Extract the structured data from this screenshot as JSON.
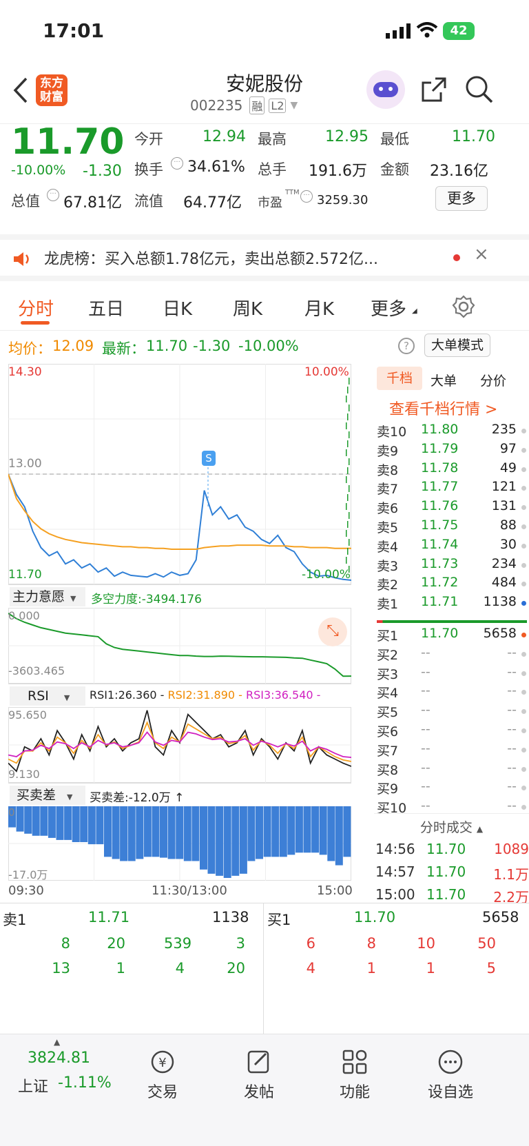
{
  "status_bar": {
    "time": "17:01",
    "battery": "42"
  },
  "header": {
    "title": "安妮股份",
    "code": "002235",
    "tag_margin": "融",
    "tag_level": "L2",
    "logo_line1": "东方",
    "logo_line2": "财富"
  },
  "quote": {
    "price": "11.70",
    "change_pct": "-10.00%",
    "change": "-1.30",
    "open_label": "今开",
    "open": "12.94",
    "high_label": "最高",
    "high": "12.95",
    "low_label": "最低",
    "low": "11.70",
    "turnover_label": "换手",
    "turnover": "34.61%",
    "volume_label": "总手",
    "volume": "191.6万",
    "amount_label": "金额",
    "amount": "23.16亿",
    "mktcap_label": "总值",
    "mktcap": "67.81亿",
    "float_label": "流值",
    "float": "64.77亿",
    "pe_label": "市盈",
    "pe_sup": "TTM",
    "pe": "3259.30",
    "more_label": "更多"
  },
  "banner": {
    "text": "龙虎榜：买入总额1.78亿元，卖出总额2.572亿..."
  },
  "tabs": [
    "分时",
    "五日",
    "日K",
    "周K",
    "月K",
    "更多"
  ],
  "info_bar": {
    "avg_label": "均价：",
    "avg": "12.09",
    "last_label": "最新：",
    "last": "11.70",
    "chg": "-1.30",
    "pct": "-10.00%",
    "mode_btn": "大单模式"
  },
  "chart_data": [
    {
      "type": "line",
      "title": "",
      "y_top_label": "14.30",
      "y_mid_label": "13.00",
      "y_bot_label": "11.70",
      "pct_top": "10.00%",
      "pct_bot": "-10.00%",
      "ylim": [
        11.7,
        14.3
      ],
      "x_labels": [
        "09:30",
        "11:30/13:00",
        "15:00"
      ],
      "series": [
        {
          "name": "price",
          "color": "#2f7fd6",
          "values": [
            13.0,
            12.75,
            12.6,
            12.3,
            12.1,
            12.0,
            12.05,
            11.9,
            11.95,
            11.85,
            11.9,
            11.8,
            11.85,
            11.75,
            11.8,
            11.76,
            11.75,
            11.74,
            11.78,
            11.74,
            11.8,
            11.76,
            11.78,
            11.95,
            12.8,
            12.5,
            12.6,
            12.45,
            12.5,
            12.35,
            12.3,
            12.2,
            12.15,
            12.25,
            12.1,
            12.05,
            11.9,
            11.8,
            11.75,
            11.76,
            11.73,
            11.71,
            11.7
          ]
        },
        {
          "name": "avg",
          "color": "#f5a020",
          "values": [
            13.0,
            12.7,
            12.55,
            12.42,
            12.33,
            12.27,
            12.23,
            12.2,
            12.18,
            12.16,
            12.15,
            12.14,
            12.13,
            12.12,
            12.11,
            12.11,
            12.1,
            12.1,
            12.09,
            12.09,
            12.08,
            12.08,
            12.08,
            12.08,
            12.1,
            12.11,
            12.12,
            12.12,
            12.13,
            12.13,
            12.13,
            12.13,
            12.12,
            12.12,
            12.12,
            12.11,
            12.11,
            12.1,
            12.1,
            12.1,
            12.09,
            12.09,
            12.09
          ]
        }
      ],
      "marker_label": "S"
    },
    {
      "type": "line",
      "title": "主力意愿",
      "subtitle": "多空力度:-3494.176",
      "y_top_label": "0.000",
      "y_bot_label": "-3603.465",
      "ylim": [
        -3603.465,
        0
      ],
      "series": [
        {
          "name": "主力意愿",
          "color": "#1a9a2a",
          "values": [
            0,
            -300,
            -500,
            -650,
            -800,
            -900,
            -1000,
            -1100,
            -1150,
            -1200,
            -1250,
            -1300,
            -1700,
            -1900,
            -2000,
            -2050,
            -2100,
            -2150,
            -2200,
            -2250,
            -2300,
            -2350,
            -2350,
            -2380,
            -2400,
            -2400,
            -2380,
            -2390,
            -2400,
            -2410,
            -2420,
            -2420,
            -2430,
            -2440,
            -2450,
            -2480,
            -2500,
            -2600,
            -2700,
            -2800,
            -3100,
            -3500,
            -3494
          ]
        }
      ]
    },
    {
      "type": "line",
      "title": "RSI",
      "legend": [
        "RSI1:26.360 -",
        "RSI2:31.890 -",
        "RSI3:36.540 -"
      ],
      "y_top_label": "95.650",
      "y_bot_label": "9.130",
      "ylim": [
        9.13,
        95.65
      ],
      "series": [
        {
          "name": "RSI1",
          "color": "#222222",
          "values": [
            30,
            20,
            50,
            45,
            60,
            40,
            70,
            55,
            35,
            65,
            45,
            75,
            50,
            60,
            45,
            55,
            60,
            95,
            50,
            40,
            70,
            55,
            90,
            80,
            70,
            60,
            65,
            50,
            55,
            70,
            40,
            60,
            50,
            35,
            55,
            45,
            70,
            30,
            50,
            40,
            35,
            30,
            26
          ]
        },
        {
          "name": "RSI2",
          "color": "#f5a020",
          "values": [
            35,
            30,
            45,
            45,
            55,
            45,
            62,
            55,
            42,
            58,
            48,
            65,
            52,
            56,
            48,
            52,
            56,
            80,
            55,
            48,
            62,
            56,
            78,
            72,
            66,
            60,
            62,
            54,
            56,
            64,
            46,
            58,
            52,
            42,
            54,
            48,
            62,
            38,
            50,
            44,
            38,
            34,
            32
          ]
        },
        {
          "name": "RSI3",
          "color": "#d020c0",
          "values": [
            40,
            38,
            45,
            46,
            52,
            48,
            56,
            54,
            48,
            55,
            50,
            58,
            53,
            55,
            50,
            52,
            55,
            68,
            56,
            52,
            58,
            56,
            68,
            66,
            62,
            59,
            60,
            56,
            57,
            60,
            52,
            57,
            54,
            50,
            54,
            51,
            57,
            45,
            50,
            47,
            42,
            38,
            37
          ]
        }
      ]
    },
    {
      "type": "bar",
      "title": "买卖差",
      "subtitle": "买卖差:-12.0万 ↑",
      "y_top_label": "0",
      "y_bot_label": "-17.0万",
      "ylim": [
        -17,
        0
      ],
      "values": [
        -5,
        -6,
        -6.5,
        -7,
        -7,
        -7.5,
        -8,
        -8,
        -8.5,
        -8.5,
        -9,
        -9,
        -12,
        -12.5,
        -13,
        -13,
        -12.5,
        -12,
        -12,
        -12.2,
        -12.5,
        -12.5,
        -13,
        -13,
        -15,
        -16,
        -16.5,
        -17,
        -16.5,
        -16,
        -13,
        -12.5,
        -12,
        -12,
        -12,
        -11.5,
        -11,
        -11,
        -11,
        -11.5,
        -13,
        -14,
        -12
      ]
    }
  ],
  "order_tabs": [
    "千档",
    "大单",
    "分价"
  ],
  "order_link": "查看千档行情 >",
  "asks": [
    {
      "label": "卖10",
      "price": "11.80",
      "vol": "235"
    },
    {
      "label": "卖9",
      "price": "11.79",
      "vol": "97"
    },
    {
      "label": "卖8",
      "price": "11.78",
      "vol": "49"
    },
    {
      "label": "卖7",
      "price": "11.77",
      "vol": "121"
    },
    {
      "label": "卖6",
      "price": "11.76",
      "vol": "131"
    },
    {
      "label": "卖5",
      "price": "11.75",
      "vol": "88"
    },
    {
      "label": "卖4",
      "price": "11.74",
      "vol": "30"
    },
    {
      "label": "卖3",
      "price": "11.73",
      "vol": "234"
    },
    {
      "label": "卖2",
      "price": "11.72",
      "vol": "484"
    },
    {
      "label": "卖1",
      "price": "11.71",
      "vol": "1138"
    }
  ],
  "bids": [
    {
      "label": "买1",
      "price": "11.70",
      "vol": "5658"
    },
    {
      "label": "买2",
      "price": "--",
      "vol": "--"
    },
    {
      "label": "买3",
      "price": "--",
      "vol": "--"
    },
    {
      "label": "买4",
      "price": "--",
      "vol": "--"
    },
    {
      "label": "买5",
      "price": "--",
      "vol": "--"
    },
    {
      "label": "买6",
      "price": "--",
      "vol": "--"
    },
    {
      "label": "买7",
      "price": "--",
      "vol": "--"
    },
    {
      "label": "买8",
      "price": "--",
      "vol": "--"
    },
    {
      "label": "买9",
      "price": "--",
      "vol": "--"
    },
    {
      "label": "买10",
      "price": "--",
      "vol": "--"
    }
  ],
  "trades_title": "分时成交",
  "trades": [
    {
      "time": "14:56",
      "price": "11.70",
      "vol": "1089"
    },
    {
      "time": "14:57",
      "price": "11.70",
      "vol": "1.1万"
    },
    {
      "time": "15:00",
      "price": "11.70",
      "vol": "2.2万"
    }
  ],
  "l2": {
    "sell_label": "卖1",
    "sell_price": "11.71",
    "sell_vol": "1138",
    "buy_label": "买1",
    "buy_price": "11.70",
    "buy_vol": "5658",
    "sell_row1": [
      "8",
      "20",
      "539",
      "3"
    ],
    "sell_row2": [
      "13",
      "1",
      "4",
      "20"
    ],
    "buy_row1": [
      "6",
      "8",
      "10",
      "50"
    ],
    "buy_row2": [
      "4",
      "1",
      "1",
      "5"
    ]
  },
  "bottom_bar": {
    "index_value": "3824.81",
    "index_name": "上证",
    "index_pct": "-1.11%",
    "trade": "交易",
    "post": "发帖",
    "func": "功能",
    "watch": "设自选"
  }
}
